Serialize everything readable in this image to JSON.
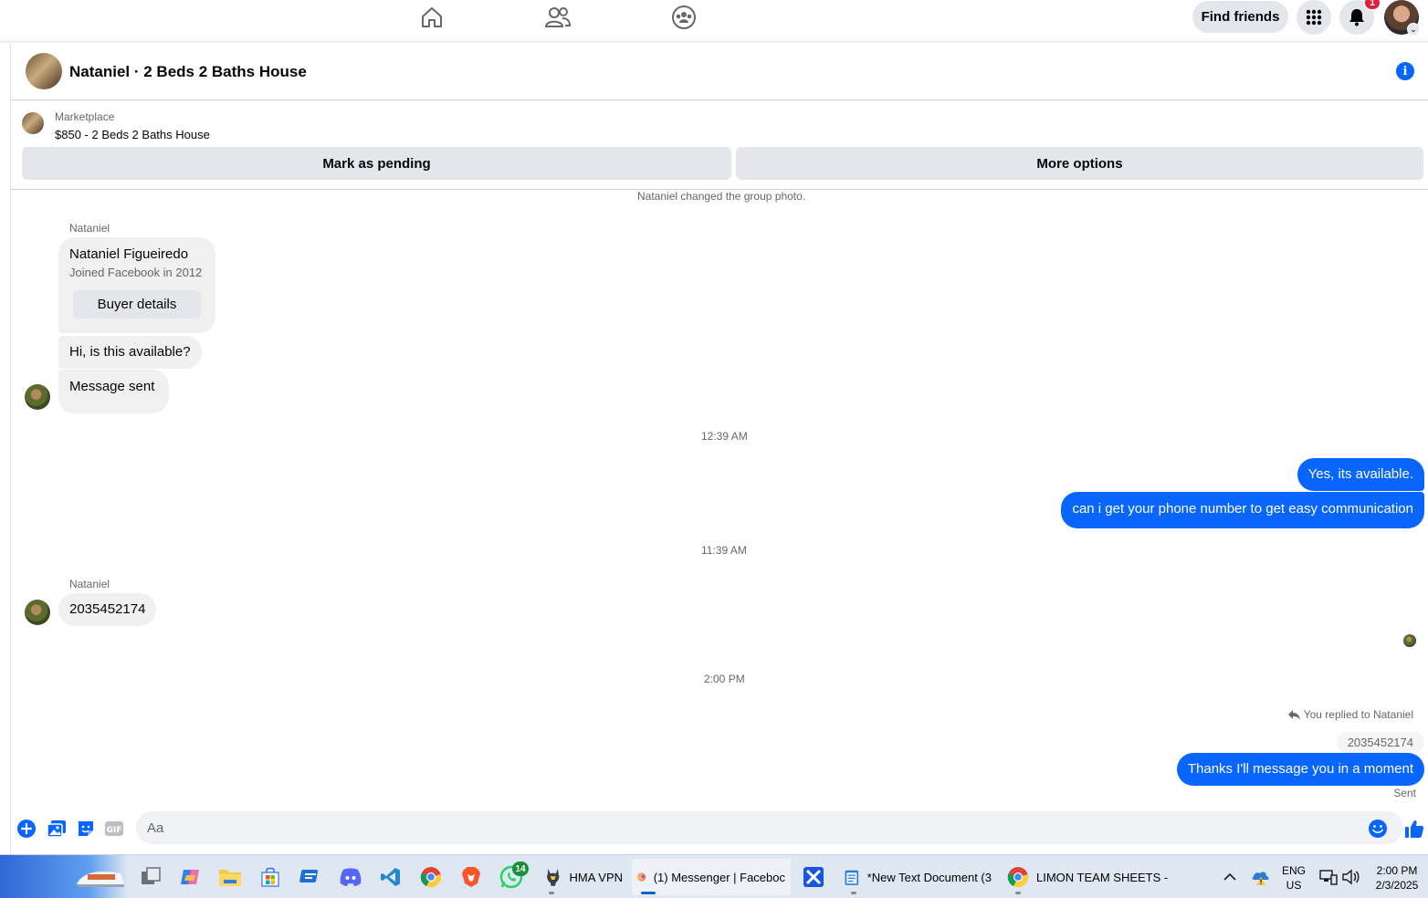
{
  "topnav": {
    "find_friends_label": "Find friends",
    "notification_count": "1"
  },
  "chat": {
    "title": "Nataniel · 2 Beds 2 Baths House"
  },
  "marketplace": {
    "source": "Marketplace",
    "listing": "$850 - 2 Beds 2 Baths House",
    "mark_pending_label": "Mark as pending",
    "more_options_label": "More options"
  },
  "messages": {
    "group_photo_notice": "Nataniel changed the group photo.",
    "sender_1": "Nataniel",
    "card": {
      "name": "Nataniel Figueiredo",
      "joined": "Joined Facebook in 2012",
      "button": "Buyer details"
    },
    "msg_available": "Hi, is this available?",
    "msg_sent_notice": "Message sent",
    "time_1": "12:39 AM",
    "out_1": "Yes, its available.",
    "out_2": "can i get your phone number to get easy communication",
    "time_2": "11:39 AM",
    "sender_2": "Nataniel",
    "msg_phone": "2035452174",
    "time_3": "2:00 PM",
    "reply_label": "You replied to Nataniel",
    "quoted": "2035452174",
    "out_3": "Thanks I'll message you in a moment",
    "status": "Sent"
  },
  "composer": {
    "placeholder": "Aa"
  },
  "taskbar": {
    "whatsapp_badge": "14",
    "apps": [
      {
        "label": "HMA VPN"
      },
      {
        "label": "(1) Messenger | Faceboc"
      },
      {
        "label": "*New Text Document (3"
      },
      {
        "label": "LIMON TEAM SHEETS -"
      }
    ],
    "lang_1": "ENG",
    "lang_2": "US",
    "time": "2:00 PM",
    "date": "2/3/2025"
  },
  "colors": {
    "accent": "#0866ff",
    "incoming_bubble": "#f0f0f0",
    "badge": "#e41e3f"
  }
}
